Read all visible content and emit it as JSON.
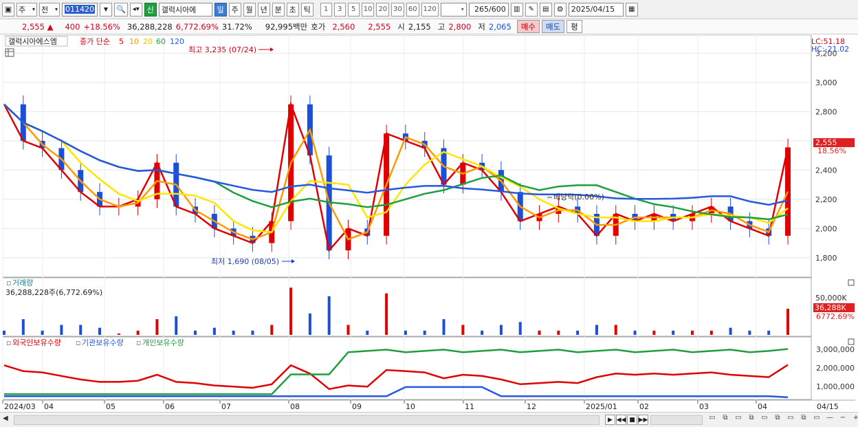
{
  "toolbar": {
    "period_select": "주",
    "prev_label": "전",
    "code": "011420",
    "credit_badge": "신",
    "stock_name": "갤럭시아에",
    "period_tabs": [
      "일",
      "주",
      "월",
      "년",
      "분",
      "초",
      "틱"
    ],
    "active_tab": "일",
    "interval_tabs": [
      "1",
      "3",
      "5",
      "10",
      "20",
      "30",
      "60",
      "120"
    ],
    "data_count": "265",
    "data_max": "/600",
    "date": "2025/04/15"
  },
  "quote": {
    "price": "2,555",
    "change_arrow": "▲",
    "change": "400",
    "change_pct": "+18.56%",
    "volume": "36,288,228",
    "volume_ratio": "6,772.69%",
    "turnover": "31.72%",
    "amount": "92,995백만",
    "ask_label": "호가",
    "ask": "2,560",
    "bid": "2,555",
    "open_label": "시",
    "open": "2,155",
    "high_label": "고",
    "high": "2,800",
    "low_label": "저",
    "low": "2,065",
    "buy_label": "매수",
    "sell_label": "매도",
    "eval_label": "평"
  },
  "price_panel": {
    "legend_name": "갤럭시아에스엠",
    "legend_ma": "종가 단순",
    "ma_periods": [
      "5",
      "10",
      "20",
      "60",
      "120"
    ],
    "ma_colors": [
      "#e00000",
      "#ff9900",
      "#ffe600",
      "#1e9e3e",
      "#2458e0"
    ],
    "high_note": "최고 3,235 (07/24)",
    "low_note": "최저 1,690 (08/05)",
    "ref_note": "배당락(0.00%)",
    "lc": "LC:51.18",
    "hc": "HC:-21.02",
    "current_price": "2,555",
    "current_pct": "18.56%",
    "yticks": [
      "3,200",
      "3,000",
      "2,800",
      "2,600",
      "2,400",
      "2,200",
      "2,000",
      "1,800"
    ]
  },
  "volume_panel": {
    "title": "거래량",
    "value": "36,288,228주(6,772.69%)",
    "ytick": "50,000K",
    "current": "36,288K",
    "current_pct": "6772.69%"
  },
  "holding_panel": {
    "series": [
      "외국인보유수량",
      "기관보유수량",
      "개인보유수량"
    ],
    "colors": [
      "#e00000",
      "#2458e0",
      "#1e9e3e"
    ],
    "yticks": [
      "3,000,000",
      "2,000,000",
      "1,000,000"
    ]
  },
  "x_axis": [
    "2024/03",
    "04",
    "05",
    "06",
    "07",
    "08",
    "09",
    "10",
    "11",
    "12",
    "2025/01",
    "02",
    "03",
    "04",
    "04/15"
  ],
  "chart_data": {
    "type": "candlestick",
    "y_range": [
      1700,
      3230
    ],
    "approx_closes_weekly": [
      2850,
      2600,
      2550,
      2400,
      2250,
      2150,
      2150,
      2200,
      2450,
      2150,
      2100,
      2000,
      1950,
      1900,
      2050,
      2850,
      2500,
      1850,
      2000,
      1950,
      2650,
      2600,
      2550,
      2300,
      2450,
      2400,
      2250,
      2050,
      2100,
      2150,
      2100,
      1950,
      2100,
      2050,
      2100,
      2050,
      2100,
      2150,
      2050,
      2000,
      1950,
      2555
    ],
    "volume_last": 36288228,
    "holdings_end": {
      "foreign": 2100000,
      "institution": 50000,
      "individual": 3100000
    }
  }
}
